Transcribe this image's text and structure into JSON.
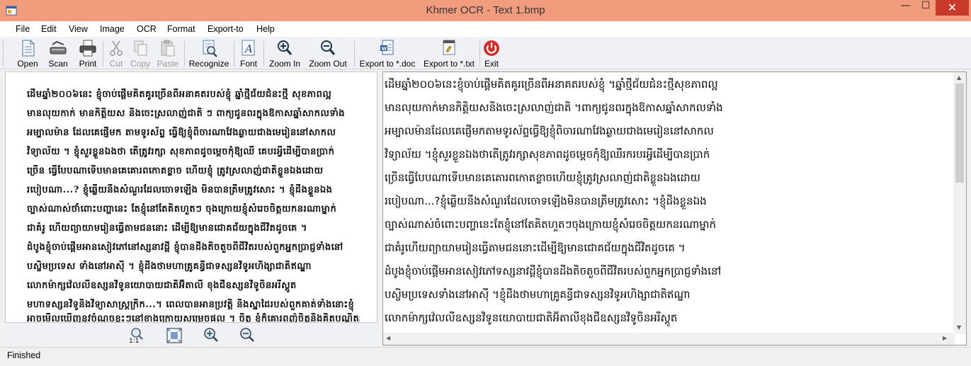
{
  "window": {
    "title": "Khmer OCR - Text 1.bmp",
    "minimize": "—",
    "maximize": "☐",
    "close": "✕"
  },
  "menu": [
    "File",
    "Edit",
    "View",
    "Image",
    "OCR",
    "Format",
    "Export-to",
    "Help"
  ],
  "toolbar": {
    "open": "Open",
    "scan": "Scan",
    "print": "Print",
    "cut": "Cut",
    "copy": "Copy",
    "paste": "Paste",
    "recognize": "Recognize",
    "font": "Font",
    "zoom_in": "Zoom In",
    "zoom_out": "Zoom Out",
    "export_doc": "Export to *.doc",
    "export_txt": "Export to *.txt",
    "exit": "Exit"
  },
  "image_zoom": {
    "actual_size_label": "1:1"
  },
  "scanned_image_lines": [
    "ដើមឆ្នាំ២០០៦នេះ ខ្ញុំចាប់ផ្ដើមគិតគូរច្រើនពីអនាគតរបស់ខ្ញុំ ឆ្នាំថ្មីជ័យជំនះថ្មី សុខភាពល្អ",
    "មានលុយកាក់ មានកិត្តិយស និងចេះស្រលាញ់ជាតិ ៗ ពាក្យជូនពរក្នុងឱកាសឆ្នាំសាកលទាំង",
    "អម្បាលម៉ាន ដែលគេផ្ញើមក តាមទូរស័ព្ទ ធ្វើឱ្យខ្ញុំពិចារណាវែងឆ្ងាយជាងមេរៀននៅសាកល",
    "វិទ្យាល័យ ។ ខ្ញុំសួរខ្លួនឯងថា តើត្រូវរក្សា សុខភាពដូចម្ដេចកុំឱ្យឈឺ គេបរអ្វីដើម្បីបានប្រាក់",
    "ច្រើន ធ្វើបែបណាទើបមានគេគោរពកោតខ្លាច ហើយខ្ញុំ ត្រូវស្រលាញ់ជាតិខ្លួនឯងដោយ",
    "របៀបណា...? ខ្ញុំឆ្លើយនឹងសំណួរដែលចោទឡើង មិនបានត្រឹមត្រូវសោះ ។ ខ្ញុំដឹងខ្លួនឯង",
    "ច្បាស់ណាស់ថាំពោះបញ្ហានេះ តែខ្ញុំនៅតែគិតហួតៗ ចុងក្រោយខ្ញុំសំរេចចិត្តយកនរណាម្នាក់",
    "ជាគំរូ ហើយព្យាយាមរៀនធ្វើតាមជននោះ ដើម្បីឱ្យមានជោគជ័យក្នុងជីវិតដូចគេ ។",
    "ដំបូងខ្ញុំចាប់ផ្ដើមអានសៀវភៅនៅស្សនាវដ្ដី ខ្ញុំបានដឹងតិចតួចពីជីវិតរបស់ពួកអ្នកប្រាជ្ញទាំងនៅ",
    "បស្ចិមប្រទេស ទាំងនៅអាស៊ី ។ ខ្ញុំដឹងថាមហាគ្រូគន្ធីជាទស្សនវិទូអហិង្សាជាតិឥណ្ឌា",
    "លោកម៉ាក្សវ៉េលលីឧស្សនវិទូនយោបាយជាតិអ៊ីតាលី ខុងជឺឧស្សនវិទូចិនអរីស្ដូត",
    "មហាទស្សនវិទូនិងវិទ្យាសាស្ត្រក្រិក...។ ពេលបានអានប្រវត្តិ និងស្នាដៃរបស់ពួកគាត់ទាំងនោះខ្ញុំ",
    "អាចមើលឃើញនូវចំណុចខ្លះៗនៅខាងក្រោយសម្រេចផល ។ ចិត្ត ខ្ញុំក៏គោរពញ៉ចិត្តនិងគិតបណ្ដិតរបស់ពួកគាត់"
  ],
  "ocr_text_lines": [
    "ដើមឆ្នាំ២០០៦នេះខ្ញុំចាប់ផ្តើមគិតគូរច្រើនពីអនាគតរបស់ខ្ញុំ ។ឆ្នាំថ្មីជ័យជំនះថ្មីសុខភាពល្អ",
    "មានលុយកាក់មានកិត្តិយសនិងចេះស្រលាញ់ជាតិ ។ពាក្យជូនពរក្នុងឱកាសឆ្នាំសាកលទាំង",
    "អម្បាលម៉ានដែលគេផ្ញើមកតាមទូរស័ព្ទធ្វើឱ្យខ្ញុំពិចារណាវែងឆ្ងាយជាងមេរៀននៅសាកល",
    "វិទ្យាល័យ ។ខ្ញុំសួរខ្លួនឯងថាតើត្រូវរក្សាសុខភាពដូចម្ដេចកុំឱ្យឈឺរករបរអ្វីដើម្បីបានប្រាក់",
    "ច្រើនធ្វើបែបណាទើបមានគេគោរពកោតខ្លាចហើយខ្ញុំត្រូវស្រលាញ់ជាតិខ្លួនឯងដោយ",
    "របៀបណា...?ខ្ញុំឆ្លើយនឹងសំណួរដែលចោទឡើងមិនបានត្រឹមត្រូវសោះ ។ខ្ញុំដឹងខ្លួនឯង",
    "ច្បាស់ណាស់ចំពោះបញ្ហានេះតែខ្ញុំនៅតែគិតហួតៗចុងក្រោយខ្ញុំសំរេចចិត្តយកនរណាម្នាក់",
    "ជាគំរូហើយព្យាយាមរៀនធ្វើតាមជននោះដើម្បីឱ្យមានជោគជ័យក្នុងជីវិតដូចគេ ។",
    "ដំបូងខ្ញុំចាប់ផ្តើមអានសៀវភៅទស្សនាវដ្តីខ្ញុំបានដឹងតិចតួចពីជីវិតរបស់ពួកអ្នកប្រាជ្ញទាំងនៅ",
    "បស្ចិមប្រទេសទាំងនៅអាស៊ី ។ខ្ញុំដឹងថាមហាគ្រូគន្ធីជាទស្សនវិទូអហិង្សាជាតិឥណ្ឌា",
    "លោកម៉ាក្សវ៉េលលីឧស្សនវិទូនយោបាយជាតិអ៊ីតាលីខុងជឺឧស្សនវិទូចិនអរីស្តូត"
  ],
  "status": "Finished"
}
